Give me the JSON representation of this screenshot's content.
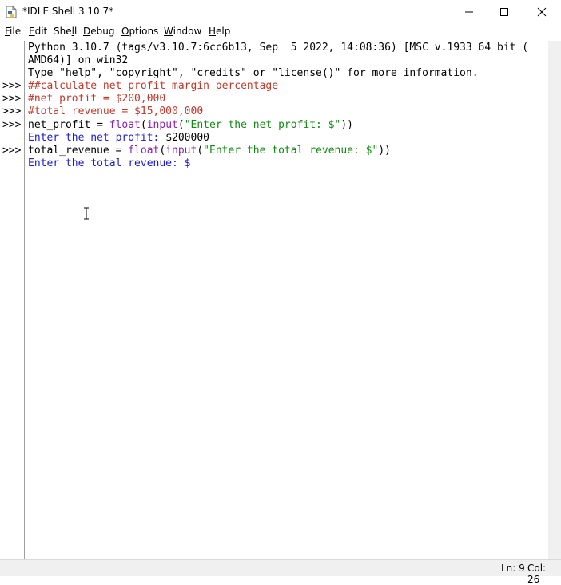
{
  "window": {
    "title": "*IDLE Shell 3.10.7*"
  },
  "menu": [
    {
      "pre": "",
      "mn": "F",
      "post": "ile"
    },
    {
      "pre": "",
      "mn": "E",
      "post": "dit"
    },
    {
      "pre": "She",
      "mn": "l",
      "post": "l"
    },
    {
      "pre": "",
      "mn": "D",
      "post": "ebug"
    },
    {
      "pre": "",
      "mn": "O",
      "post": "ptions"
    },
    {
      "pre": "",
      "mn": "W",
      "post": "indow"
    },
    {
      "pre": "",
      "mn": "H",
      "post": "elp"
    }
  ],
  "shell": {
    "prompt": ">>>",
    "banner1": "Python 3.10.7 (tags/v3.10.7:6cc6b13, Sep  5 2022, 14:08:36) [MSC v.1933 64 bit (",
    "banner2": "AMD64)] on win32",
    "banner3": "Type \"help\", \"copyright\", \"credits\" or \"license()\" for more information.",
    "c1": "##calculate net profit margin percentage",
    "c2": "#net profit = $200,000",
    "c3": "#total revenue = $15,000,000",
    "l4": {
      "a": "net_profit = ",
      "b": "float",
      "c": "(",
      "d": "input",
      "e": "(",
      "f": "\"Enter the net profit: $\"",
      "g": "))"
    },
    "o4": "Enter the net profit: ",
    "i4": "$200000",
    "l5": {
      "a": "total_revenue = ",
      "b": "float",
      "c": "(",
      "d": "input",
      "e": "(",
      "f": "\"Enter the total revenue: $\"",
      "g": "))"
    },
    "o5": "Enter the total revenue: $"
  },
  "status": {
    "ln": "Ln: 9",
    "col": "Col: 26"
  }
}
